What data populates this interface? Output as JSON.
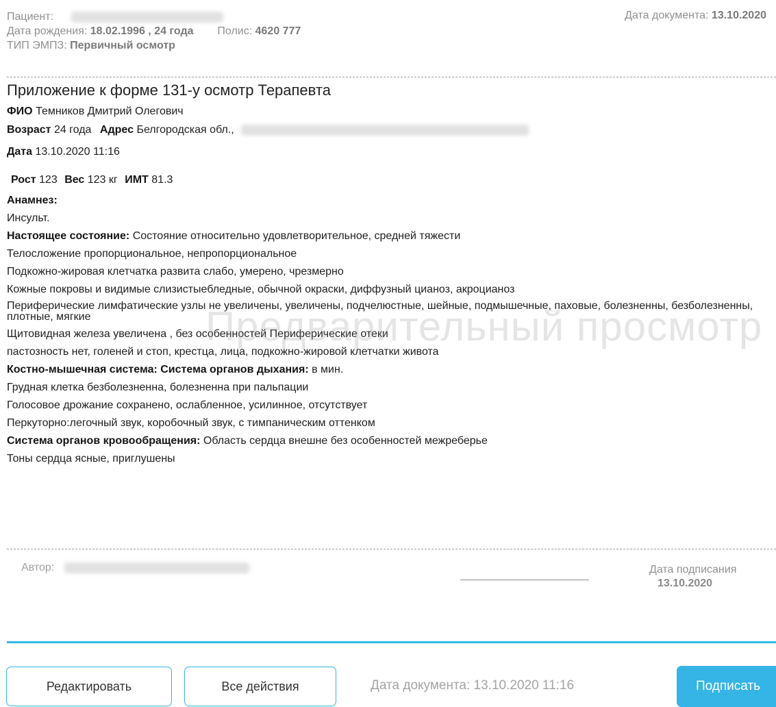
{
  "header": {
    "patient_label": "Пациент:",
    "birth_label": "Дата рождения:",
    "birth_value": "18.02.1996 , 24 года",
    "policy_label": "Полис:",
    "policy_value": "4620 777",
    "emp_label": "ТИП ЭМПЗ:",
    "emp_value": "Первичный осмотр",
    "doc_date_label": "Дата документа:",
    "doc_date_value": "13.10.2020"
  },
  "document": {
    "title": "Приложение к форме 131-у осмотр Терапевта",
    "fio_label": "ФИО",
    "fio_value": "Темников Дмитрий Олегович",
    "age_label": "Возраст",
    "age_value": "24 года",
    "address_label": "Адрес",
    "address_value": "Белгородская обл.,",
    "date_label": "Дата",
    "date_value": "13.10.2020 11:16",
    "height_label": "Рост",
    "height_value": "123",
    "weight_label": "Вес",
    "weight_value": "123 кг",
    "bmi_label": "ИМТ",
    "bmi_value": "81.3",
    "anamnesis_label": "Анамнез:",
    "anamnesis_value": "Инсульт.",
    "state_label": "Настоящее состояние:",
    "state_value": "Состояние относительно удовлетворительное, средней тяжести",
    "line_body": "Телосложение пропорциональное, непропорциональное",
    "line_fat": "Подкожно-жировая клетчатка развита слабо, умерено, чрезмерно",
    "line_skin": "Кожные покровы и видимые слизистыебледные, обычной окраски, диффузный цианоз, акроцианоз",
    "line_lymph": "Периферические лимфатические узлы не увеличены, увеличены, подчелюстные, шейные, подмышечные, паховые, болезненны, безболезненны, плотные, мягкие",
    "line_thyroid": "Щитовидная железа увеличена , без особенностей Периферические отеки",
    "line_edema": "пастозность нет, голеней и стоп, крестца, лица, подкожно-жировой клетчатки живота",
    "musc_label": "Костно-мышечная система: Система органов дыхания:",
    "musc_value": "в мин.",
    "line_chest": "Грудная клетка безболезненна, болезненна при пальпации",
    "line_voice": "Голосовое дрожание сохранено, ослабленное, усилинное, отсутствует",
    "line_percussion": "Перкуторно:легочный звук, коробочный звук, с тимпаническим оттенком",
    "circ_label": "Система органов кровообращения:",
    "circ_value": "Область сердца внешне без особенностей  межреберье",
    "line_heart": "Тоны сердца ясные, приглушены"
  },
  "watermark": "Предварительный просмотр",
  "signature": {
    "author_label": "Автор:",
    "sign_date_label": "Дата подписания",
    "sign_date_value": "13.10.2020"
  },
  "footer": {
    "edit_label": "Редактировать",
    "all_actions_label": "Все действия",
    "doc_date_text": "Дата документа: 13.10.2020 11:16",
    "sign_label": "Подписать"
  },
  "colors": {
    "accent": "#35b5e5",
    "muted_text": "#8f8f8f"
  }
}
